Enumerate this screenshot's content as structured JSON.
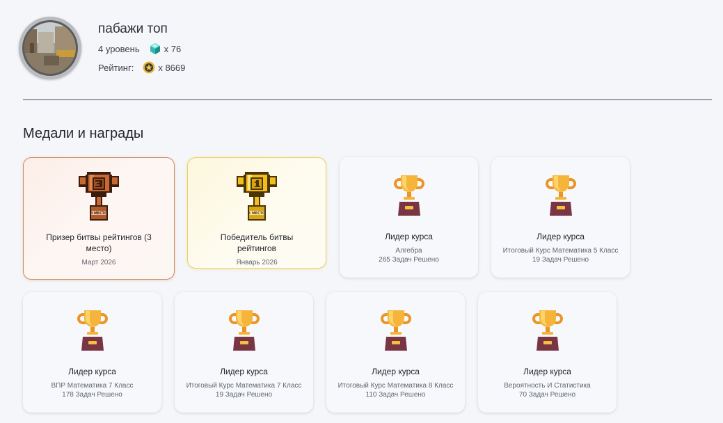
{
  "profile": {
    "username": "пабажи топ",
    "level_text": "4 уровень",
    "gems_text": "x 76",
    "rating_label": "Рейтинг:",
    "rating_text": "x 8669"
  },
  "medals": {
    "title": "Медали и награды",
    "cards": [
      {
        "title": "Призер битвы рейтингов (3 место)",
        "sub": "Март 2026",
        "sub2": "",
        "icon": "bronze-pixel-trophy-icon"
      },
      {
        "title": "Победитель битвы рейтингов",
        "sub": "Январь 2026",
        "sub2": "",
        "icon": "gold-pixel-trophy-icon"
      },
      {
        "title": "Лидер курса",
        "sub": "Алгебра",
        "sub2": "265 Задач Решено",
        "icon": "trophy-icon"
      },
      {
        "title": "Лидер курса",
        "sub": "Итоговый Курс Математика 5 Класс",
        "sub2": "19 Задач Решено",
        "icon": "trophy-icon"
      },
      {
        "title": "Лидер курса",
        "sub": "ВПР Математика 7 Класс",
        "sub2": "178 Задач Решено",
        "icon": "trophy-icon"
      },
      {
        "title": "Лидер курса",
        "sub": "Итоговый Курс Математика 7 Класс",
        "sub2": "19 Задач Решено",
        "icon": "trophy-icon"
      },
      {
        "title": "Лидер курса",
        "sub": "Итоговый Курс Математика 8 Класс",
        "sub2": "110 Задач Решено",
        "icon": "trophy-icon"
      },
      {
        "title": "Лидер курса",
        "sub": "Вероятность И Статистика",
        "sub2": "70 Задач Решено",
        "icon": "trophy-icon"
      }
    ]
  },
  "colors": {
    "background": "#f5f6fa",
    "bronze_border": "#cf8b5f",
    "gold_border": "#ecd060",
    "trophy_gold": "#f2a62a",
    "trophy_base": "#7a3544"
  }
}
